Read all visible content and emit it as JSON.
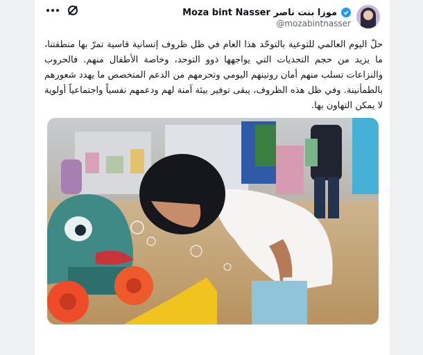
{
  "author": {
    "display_name": "Moza bint Nasser موزا بنت ناصر",
    "handle": "@mozabintnasser",
    "verified": true
  },
  "tweet": {
    "text": "حلّ اليوم العالمي للتوعية بالتوحّد هذا العام في ظل ظروف إنسانية قاسية تمرّ بها منطقتنا، ما يزيد من حجم التحديات التي يواجهها ذوو التوحد، وخاصة الأطفال منهم. فالحروب والنزاعات تسلب منهم أمان روتينهم اليومي وتحرمهم من الدعم المتخصص ما يهدد شعورهم بالطمأنينة.  وفي ظل هذه الظروف، يبقى توفير بيئة آمنة لهم ودعمهم نفسياً واجتماعياً أولوية لا يمكن التهاون بها."
  },
  "actions": {
    "more_icon": "more-horizontal-icon",
    "grok_icon": "grok-icon"
  },
  "colors": {
    "verified": "#1d9bf0",
    "text": "#0f1419",
    "secondary": "#536471"
  }
}
